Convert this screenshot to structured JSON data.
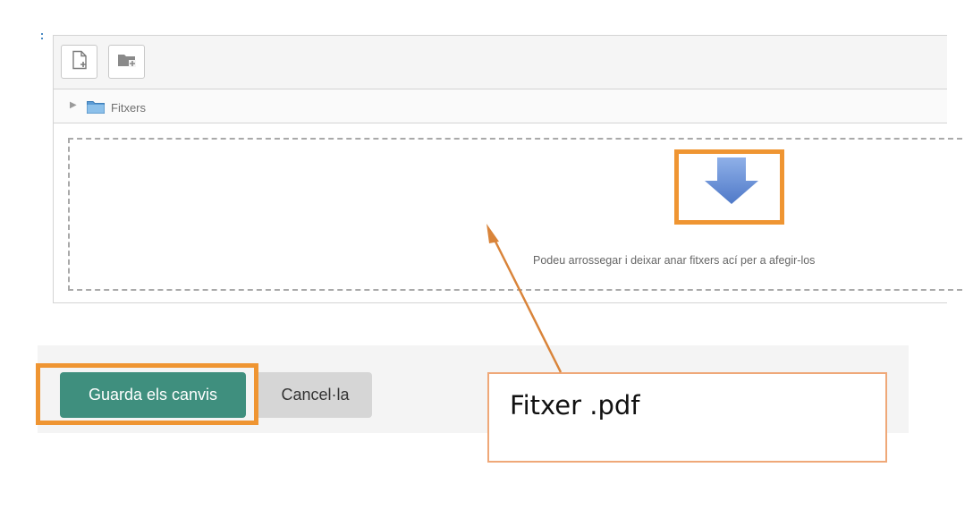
{
  "toolbar": {
    "add_file_icon": "file-add-icon",
    "create_folder_icon": "folder-add-icon"
  },
  "path_bar": {
    "folder_label": "Fitxers",
    "toggle_icon": "triangle-right-icon",
    "folder_icon": "folder-icon"
  },
  "dropzone": {
    "icon": "down-arrow-icon",
    "instruction": "Podeu arrossegar i deixar anar fitxers ací per a afegir-los"
  },
  "actions": {
    "save_label": "Guarda els canvis",
    "cancel_label": "Cancel·la"
  },
  "annotation": {
    "file_label": "Fitxer .pdf",
    "highlight_color": "#ef9532",
    "arrow_color": "#d9843a"
  },
  "colors": {
    "save_button": "#3f8f7e",
    "cancel_button": "#d6d6d6",
    "drop_arrow": "#6a8fd4"
  }
}
